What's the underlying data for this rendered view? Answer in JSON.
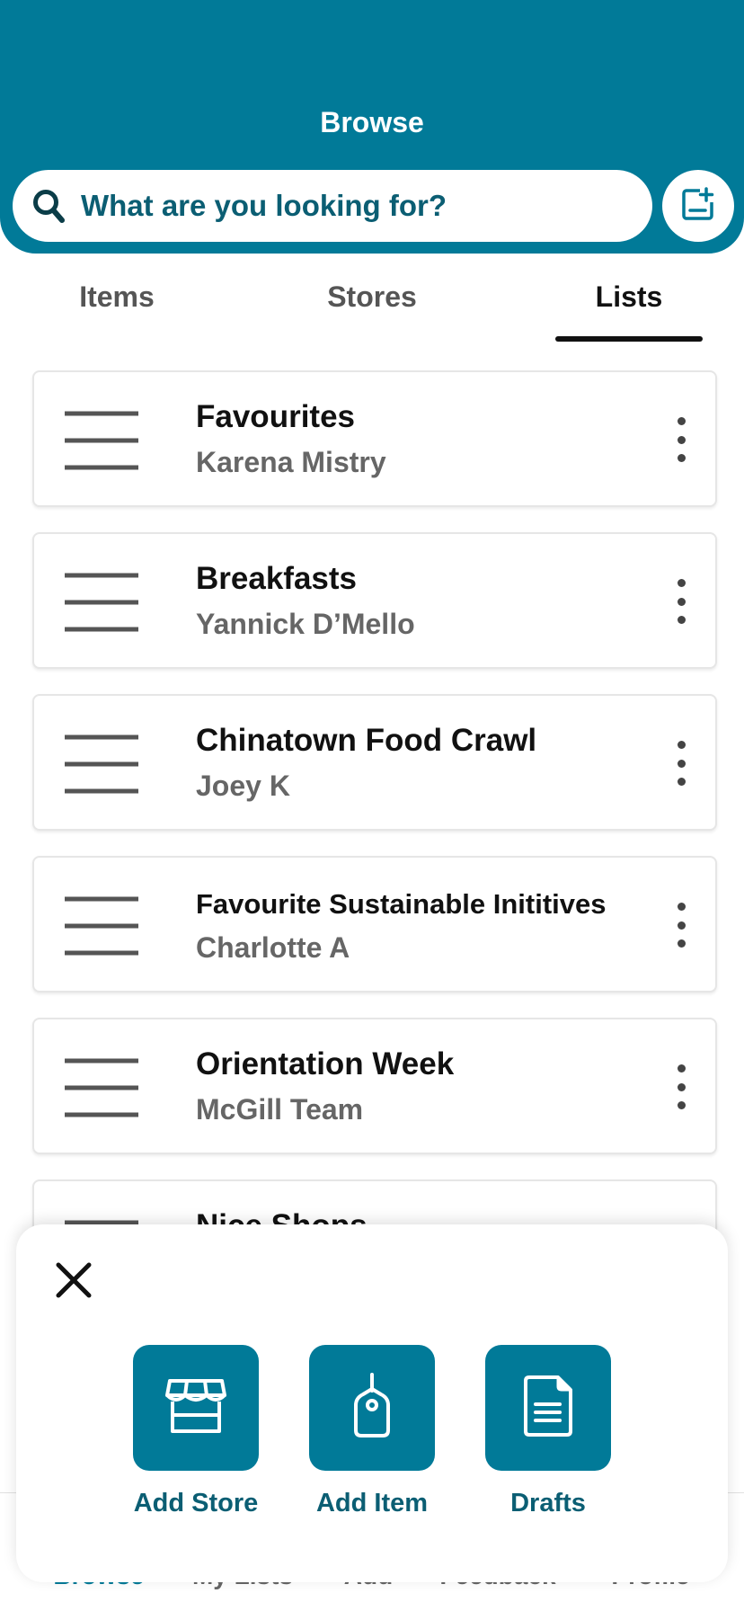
{
  "header": {
    "title": "Browse",
    "search_placeholder": "What are you looking for?"
  },
  "tabs": [
    {
      "label": "Items",
      "active": false
    },
    {
      "label": "Stores",
      "active": false
    },
    {
      "label": "Lists",
      "active": true
    }
  ],
  "lists": [
    {
      "title": "Favourites",
      "author": "Karena Mistry"
    },
    {
      "title": "Breakfasts",
      "author": "Yannick D’Mello"
    },
    {
      "title": "Chinatown Food Crawl",
      "author": "Joey K"
    },
    {
      "title": "Favourite Sustainable Inititives",
      "author": "Charlotte A"
    },
    {
      "title": "Orientation Week",
      "author": "McGill Team"
    },
    {
      "title": "Nice Shops",
      "author": ""
    }
  ],
  "add_sheet": {
    "actions": [
      {
        "label": "Add Store",
        "icon": "store-icon"
      },
      {
        "label": "Add Item",
        "icon": "tag-icon"
      },
      {
        "label": "Drafts",
        "icon": "document-icon"
      }
    ]
  },
  "bottom_nav": [
    {
      "label": "Browse",
      "active": true
    },
    {
      "label": "My Lists",
      "active": false
    },
    {
      "label": "Add",
      "active": false
    },
    {
      "label": "Feedback",
      "active": false
    },
    {
      "label": "Profile",
      "active": false
    }
  ],
  "colors": {
    "primary": "#017a98",
    "primary_text": "#0b5e73",
    "muted_text": "#666666"
  }
}
